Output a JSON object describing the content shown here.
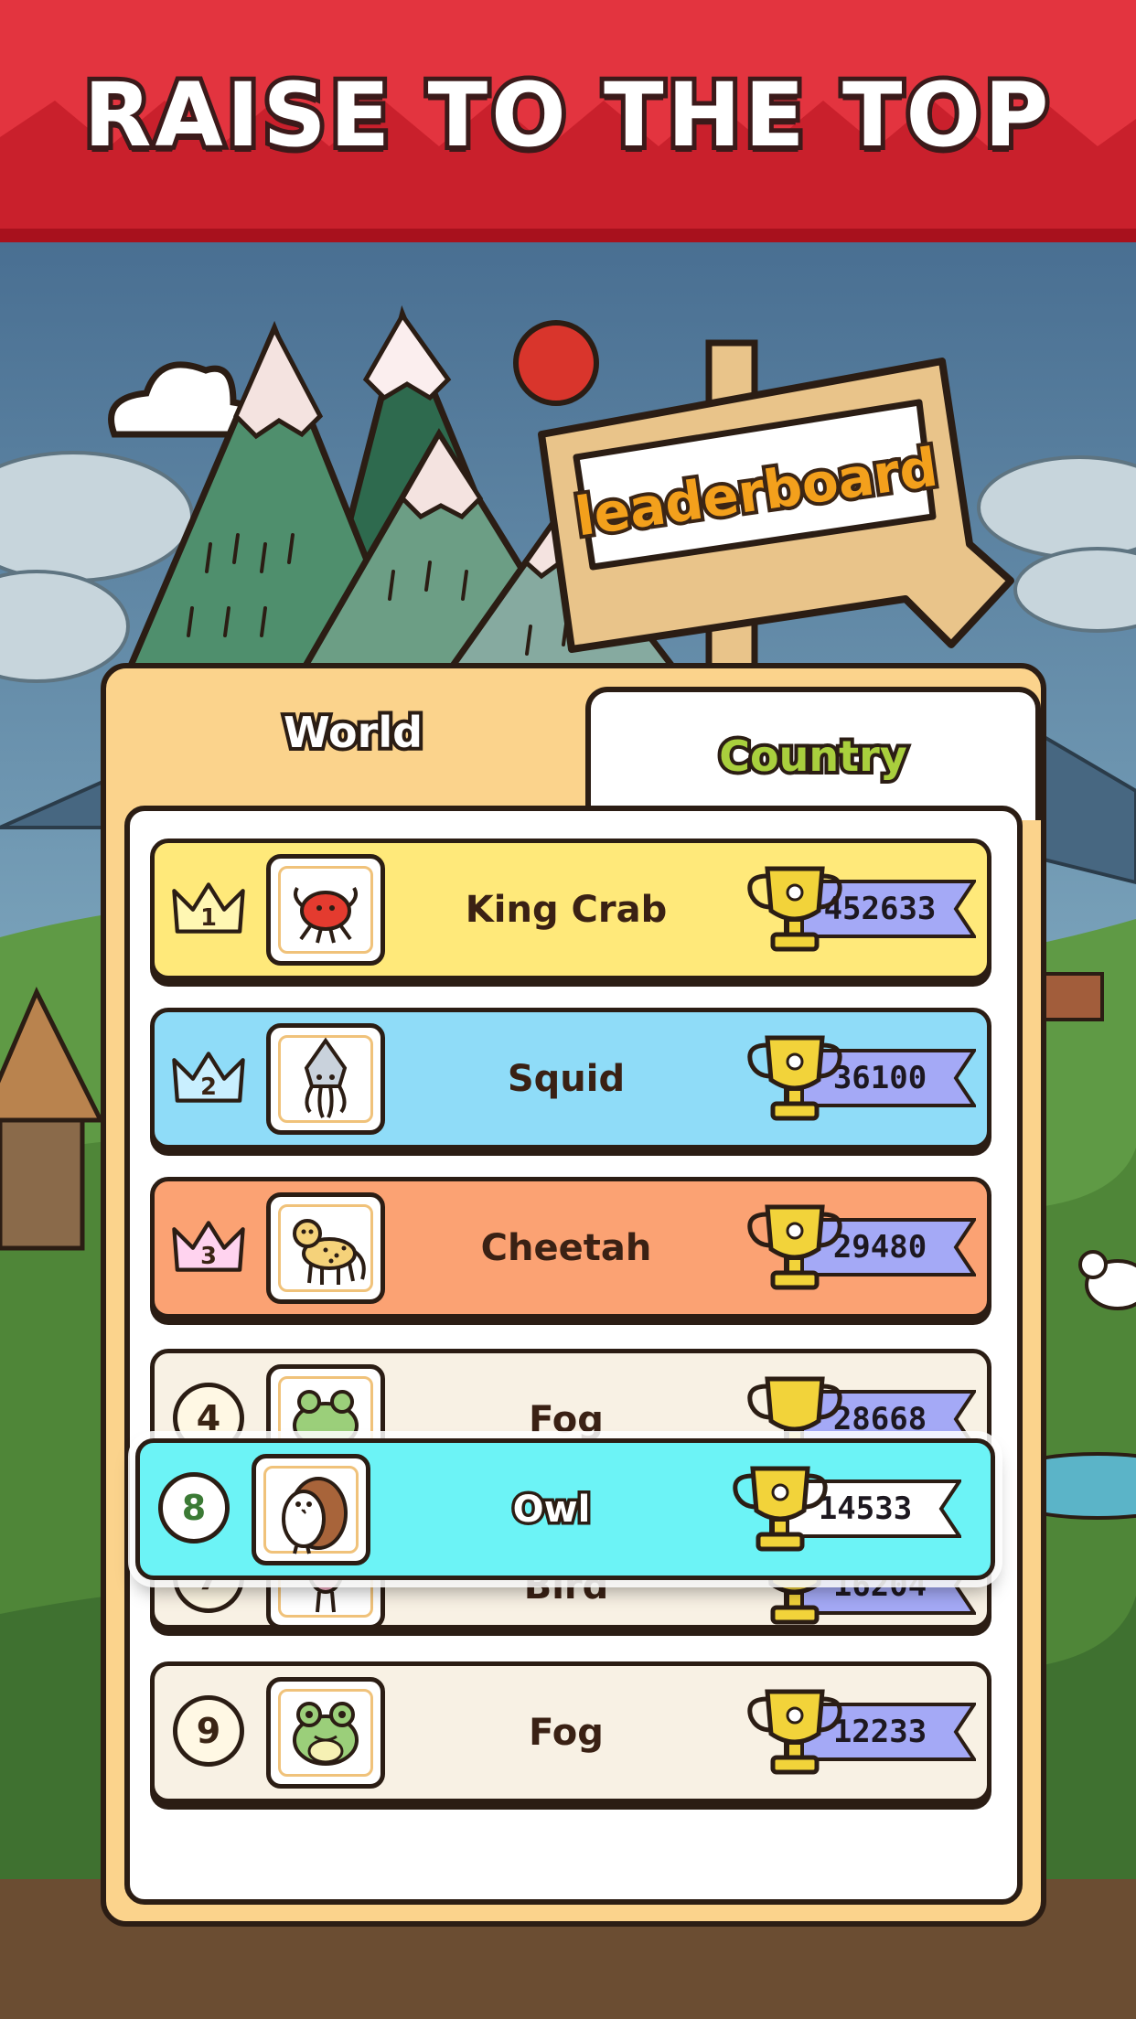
{
  "banner": {
    "title": "RAISE TO THE TOP"
  },
  "sign": {
    "label": "leaderboard"
  },
  "tabs": [
    {
      "label": "World",
      "selected": false
    },
    {
      "label": "Country",
      "selected": true
    }
  ],
  "leaderboard": {
    "rows": [
      {
        "rank": "1",
        "name": "King Crab",
        "score": "452633",
        "animal_icon": "crab-icon",
        "badge": "gold-crown"
      },
      {
        "rank": "2",
        "name": "Squid",
        "score": "36100",
        "animal_icon": "squid-icon",
        "badge": "blue-crown"
      },
      {
        "rank": "3",
        "name": "Cheetah",
        "score": "29480",
        "animal_icon": "cheetah-icon",
        "badge": "pink-crown"
      },
      {
        "rank": "4",
        "name": "Fog",
        "score": "28668",
        "animal_icon": "frog-icon",
        "badge": "circle"
      },
      {
        "rank": "7",
        "name": "Bird",
        "score": "16204",
        "animal_icon": "bird-icon",
        "badge": "circle"
      },
      {
        "rank": "9",
        "name": "Fog",
        "score": "12233",
        "animal_icon": "frog-icon",
        "badge": "circle"
      }
    ],
    "current_player": {
      "rank": "8",
      "name": "Owl",
      "score": "14533",
      "animal_icon": "owl-icon"
    }
  },
  "colors": {
    "banner": "#e3343f",
    "gold_row": "#ffe97a",
    "silver_row": "#8fdcf8",
    "bronze_row": "#fba273",
    "player_row": "#6cf3f6",
    "score_ribbon": "#a4a9f6"
  }
}
